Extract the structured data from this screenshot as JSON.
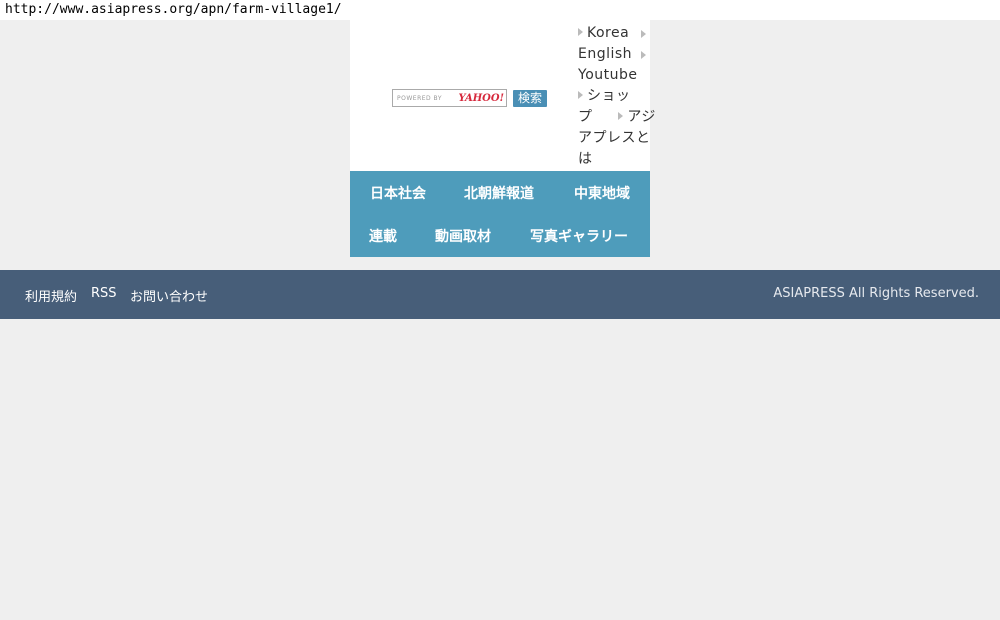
{
  "page": {
    "url": "http://www.asiapress.org/apn/farm-village1/"
  },
  "search": {
    "powered_by": "POWERED BY",
    "provider": "YAHOO!",
    "button_label": "検索"
  },
  "lang_links": {
    "korea": "Korea",
    "english": "English",
    "youtube": "Youtube",
    "shop_line1": "ショッ",
    "shop_line2": "プ",
    "about_line1": "アジ",
    "about_line2": "アプレスと",
    "about_line3": "は"
  },
  "nav": {
    "items": [
      "日本社会",
      "北朝鮮報道",
      "中東地域",
      "連載",
      "動画取材",
      "写真ギャラリー"
    ]
  },
  "footer": {
    "links": [
      "利用規約",
      "RSS",
      "お問い合わせ"
    ],
    "copyright": "ASIAPRESS All Rights Reserved."
  },
  "colors": {
    "page_background": "#efefef",
    "nav_background": "#4e9cbb",
    "footer_background": "#475e79",
    "search_button": "#4a8fb5"
  }
}
